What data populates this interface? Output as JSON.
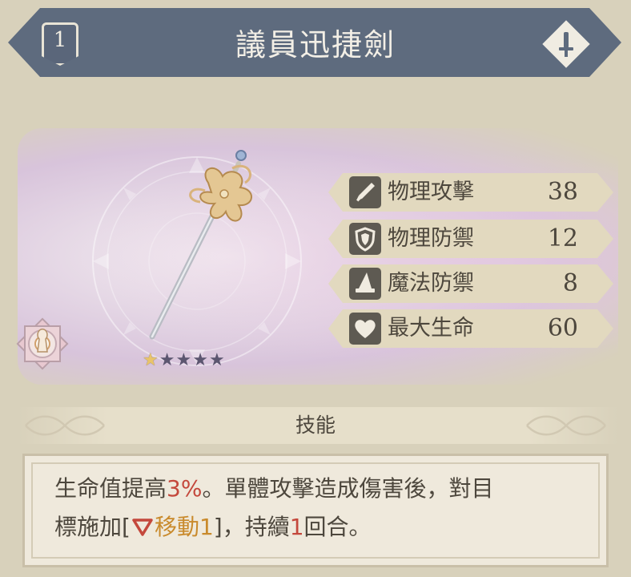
{
  "header": {
    "level": "1",
    "weapon_name": "議員迅捷劍",
    "weapon_type_icon": "sword-icon"
  },
  "rarity": {
    "filled": 1,
    "total": 5
  },
  "stats": [
    {
      "icon": "sword-icon",
      "label": "物理攻擊",
      "value": "38"
    },
    {
      "icon": "shield-icon",
      "label": "物理防禦",
      "value": "12"
    },
    {
      "icon": "wizard-hat-icon",
      "label": "魔法防禦",
      "value": "8"
    },
    {
      "icon": "heart-icon",
      "label": "最大生命",
      "value": "60"
    }
  ],
  "skill": {
    "title": "技能",
    "line1_part1": "生命值提高",
    "line1_hl": "3%",
    "line1_part2": "。單體攻擊造成傷害後，對目",
    "line2_part1": "標施加[",
    "line2_effect": "移動1",
    "line2_part2": "]，持續",
    "line2_turns": "1",
    "line2_part3": "回合。"
  },
  "colors": {
    "banner": "#5e6b7e",
    "stat_bg": "#e2d9bf",
    "highlight_red": "#c4483c",
    "highlight_orange": "#c98a2c",
    "star_filled": "#e9c46a",
    "star_empty": "#5c5670"
  }
}
